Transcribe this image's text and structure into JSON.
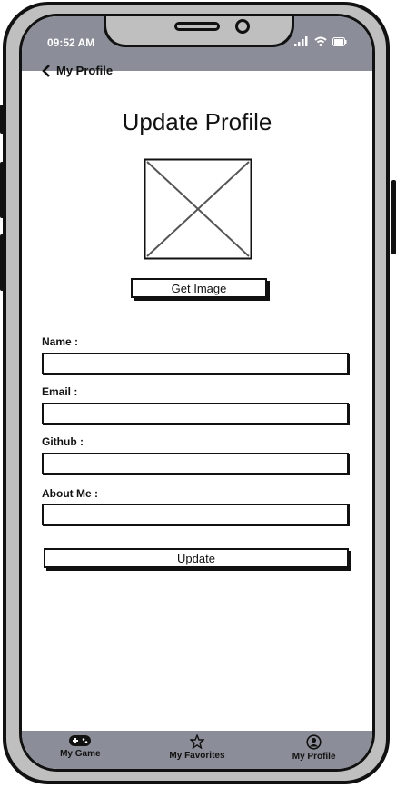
{
  "status_bar": {
    "time": "09:52 AM",
    "icons": [
      "signal-icon",
      "wifi-icon",
      "battery-icon"
    ]
  },
  "nav": {
    "back_label": "My Profile"
  },
  "page": {
    "title": "Update Profile",
    "get_image_label": "Get Image"
  },
  "form": {
    "fields": [
      {
        "label": "Name :",
        "value": ""
      },
      {
        "label": "Email :",
        "value": ""
      },
      {
        "label": "Github :",
        "value": ""
      },
      {
        "label": "About Me :",
        "value": ""
      }
    ],
    "submit_label": "Update"
  },
  "tabs": [
    {
      "label": "My Game",
      "icon": "gamepad-icon"
    },
    {
      "label": "My Favorites",
      "icon": "star-icon"
    },
    {
      "label": "My Profile",
      "icon": "user-circle-icon"
    }
  ],
  "colors": {
    "bar": "#8b8e98",
    "frame": "#bfbfbf",
    "ink": "#111111"
  }
}
